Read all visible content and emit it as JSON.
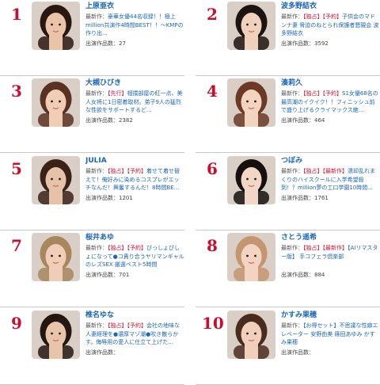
{
  "labels": {
    "latest": "最新作：",
    "count": "出演作品数："
  },
  "cards": [
    {
      "rank": "1",
      "name": "上原亜衣",
      "tags": [],
      "title": "豪華女優44名収録！！極上million共演作4時間BEST！！～KMPの作り出...",
      "count": "27",
      "skin": "#e9c4a8",
      "hair": "#2a1810"
    },
    {
      "rank": "2",
      "name": "波多野結衣",
      "tags": [
        "【独占】",
        "【予約】"
      ],
      "title": "子供会のマドンナ妻 脅迫のねとられ保護者懇親会 波多野結衣",
      "count": "3592",
      "skin": "#f0d2bc",
      "hair": "#1c1410"
    },
    {
      "rank": "3",
      "name": "大槻ひびき",
      "tags": [
        "【先行】"
      ],
      "title": "相撲部屋の紅一点、美人女将に1日密着取材。弟子9人の猛烈な性欲をサポートするど...",
      "count": "2382",
      "skin": "#f0cdb4",
      "hair": "#5a3222"
    },
    {
      "rank": "4",
      "name": "湊莉久",
      "tags": [
        "【独占】",
        "【予約】"
      ],
      "title": "S1女優68名の最高潮のイクイク！！フィニッシュ前で盛り上げるクライマックス絶...",
      "count": "464",
      "skin": "#f2d4c0",
      "hair": "#6b3a26"
    },
    {
      "rank": "5",
      "name": "JULIA",
      "tags": [
        "【独占】",
        "【予約】"
      ],
      "title": "着せて着せ替えて！俺好みに染めるコスプレがエッチなんだ！興奮するんだ！8時間BE...",
      "count": "1201",
      "skin": "#e6c2a8",
      "hair": "#3a2218"
    },
    {
      "rank": "6",
      "name": "つぼみ",
      "tags": [
        "【独占】",
        "【最新作】"
      ],
      "title": "濡却乱れまくりのハイスクールに入学希望殺到！？million夢の工口学園10時間...",
      "count": "1761",
      "skin": "#f2d6c6",
      "hair": "#15100e"
    },
    {
      "rank": "7",
      "name": "桜井あゆ",
      "tags": [
        "【独占】",
        "【予約】"
      ],
      "title": "ぴっしょぴしょになって●コ責り合うヤリマンギャルのレズSEX 厳選ベスト5時間",
      "count": "701",
      "skin": "#efcdb6",
      "hair": "#a8865e"
    },
    {
      "rank": "8",
      "name": "さとう遥希",
      "tags": [
        "【独占】",
        "【最新作】"
      ],
      "title": "【AIリマスター版】 手コフェラ倶楽部",
      "count": "884",
      "skin": "#f3d4c2",
      "hair": "#c49670"
    },
    {
      "rank": "9",
      "name": "椎名ゆな",
      "tags": [
        "【独占】",
        "【予約】"
      ],
      "title": "会社の地味な人妻経理を●濃厚マゾ潮●吹き散らかす。侮辱用の愛人に仕立て上げた...",
      "count": "",
      "skin": "#e8c4aa",
      "hair": "#241610"
    },
    {
      "rank": "10",
      "name": "かすみ果穂",
      "tags": [],
      "title": "【お得セット】不思議な性癖エレベーター 安野由美 篠田あゆみ かすみ果穂",
      "count": "",
      "skin": "#f0d0bc",
      "hair": "#4a2c1e"
    }
  ]
}
